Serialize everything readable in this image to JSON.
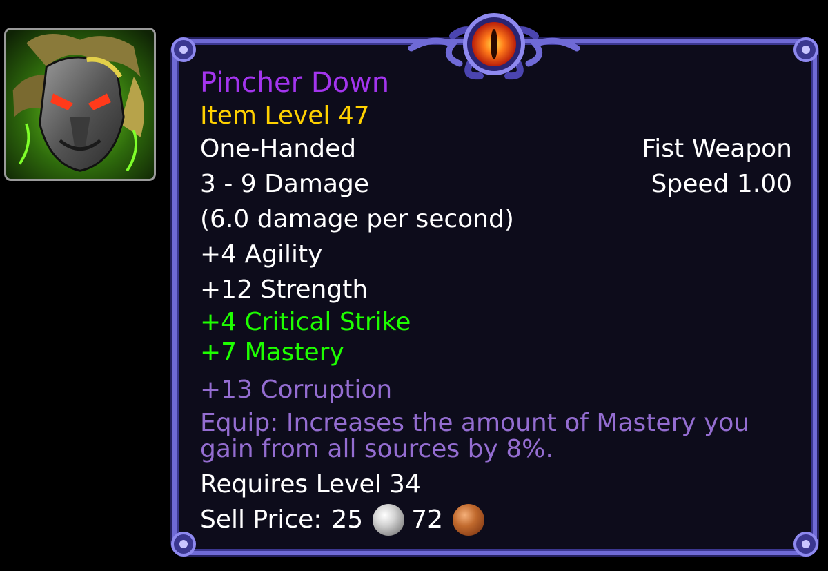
{
  "item": {
    "name": "Pincher Down",
    "item_level": "Item Level 47",
    "hand": "One-Handed",
    "weapon_type": "Fist Weapon",
    "damage": "3 - 9 Damage",
    "speed": "Speed 1.00",
    "dps": "(6.0 damage per second)",
    "stats": [
      "+4 Agility",
      "+12 Strength"
    ],
    "secondary_stats": [
      "+4 Critical Strike",
      "+7 Mastery"
    ],
    "corruption": "+13 Corruption",
    "equip_effect": "Equip: Increases the amount of Mastery you gain from all sources by 8%.",
    "requirement": "Requires Level 34",
    "sell_price": {
      "label": "Sell Price:",
      "silver": "25",
      "copper": "72"
    }
  },
  "icons": {
    "item_icon": "helm-portrait-icon",
    "ornament": "eye-ornament-icon",
    "silver_coin": "silver-coin-icon",
    "copper_coin": "copper-coin-icon"
  },
  "colors": {
    "epic": "#a335ee",
    "item_level": "#ffd100",
    "bonus_stat": "#1eff00",
    "corruption": "#946dd1",
    "frame_border": "#6f6ad6",
    "background": "#0d0c1b"
  }
}
